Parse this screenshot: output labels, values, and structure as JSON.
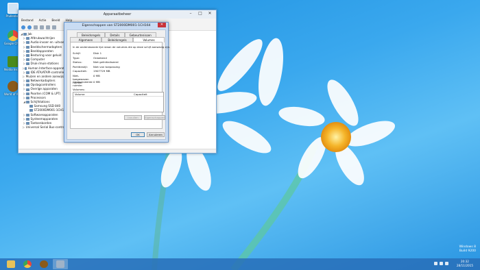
{
  "desktop": {
    "icons": [
      {
        "label": "Prullenbak",
        "icon": "recycle-bin-icon",
        "color": "#cfe3f5"
      },
      {
        "label": "Google Chrome",
        "icon": "chrome-icon",
        "color": "#e8453c"
      },
      {
        "label": "Nvidia Inspector",
        "icon": "nvidia-icon",
        "color": "#4a8a1c"
      },
      {
        "label": "World of Warcraft",
        "icon": "wow-icon",
        "color": "#8a5a1a"
      }
    ],
    "watermark": {
      "line1": "Windows 8",
      "line2": "Build 9200"
    }
  },
  "device_manager": {
    "title": "Apparaatbeheer",
    "menu": [
      "Bestand",
      "Actie",
      "Beeld",
      "Help"
    ],
    "root": "Jak",
    "tree": [
      {
        "label": "Afdrukwachtrijen",
        "expanded": false
      },
      {
        "label": "Audio-invoer en -uitvoer",
        "expanded": false
      },
      {
        "label": "Beeldschermadapters",
        "expanded": false
      },
      {
        "label": "Beeldapparaten",
        "expanded": false
      },
      {
        "label": "Besturing voor geluid",
        "expanded": false
      },
      {
        "label": "Computer",
        "expanded": false
      },
      {
        "label": "Druk-/muis-stations",
        "expanded": false
      },
      {
        "label": "Human Interface-apparaten",
        "expanded": false
      },
      {
        "label": "IDE ATA/ATAPI-controllers",
        "expanded": false
      },
      {
        "label": "Muizen en andere aanwijsapparaten",
        "expanded": false
      },
      {
        "label": "Netwerkadapters",
        "expanded": false
      },
      {
        "label": "Opslagcontrollers",
        "expanded": false
      },
      {
        "label": "Overige apparaten",
        "expanded": false
      },
      {
        "label": "Poorten (COM & LPT)",
        "expanded": false
      },
      {
        "label": "Processors",
        "expanded": false
      },
      {
        "label": "Schijfstations",
        "expanded": true
      },
      {
        "label": "Samsung SSD 840",
        "child": true
      },
      {
        "label": "ST2000DM001-1CH164",
        "child": true
      },
      {
        "label": "Softwareapparaten",
        "expanded": false
      },
      {
        "label": "Systeemapparaten",
        "expanded": false
      },
      {
        "label": "Toetsenborden",
        "expanded": false
      },
      {
        "label": "Universal Serial Bus-controllers",
        "expanded": false
      }
    ]
  },
  "dialog": {
    "title": "Eigenschappen van ST2000DM001-1CH164",
    "tabs_row1": [
      "Beleidsregels",
      "Details",
      "Gebeurtenissen"
    ],
    "tabs_row2": [
      "Algemeen",
      "Beleidsregels",
      "Volumes"
    ],
    "active_tab": "Volumes",
    "description": "In de onderstaande lijst staan de volumes die op deze schijf aanwezig zijn.",
    "fields": [
      {
        "key": "Schijf:",
        "value": "Disk 1"
      },
      {
        "key": "Type:",
        "value": "Onbekend"
      },
      {
        "key": "Status:",
        "value": "Niet geïnitialiseerd"
      },
      {
        "key": "Partitiestijl:",
        "value": "Niet van toepassing"
      },
      {
        "key": "Capaciteit:",
        "value": "1907729 MB"
      },
      {
        "key": "Niet-toegewezen ruimte:",
        "value": "0 MB"
      },
      {
        "key": "Gereserveerde ruimte:",
        "value": "0 MB"
      }
    ],
    "volumes_label": "Volumes:",
    "table_headers": [
      "Volume",
      "Capaciteit"
    ],
    "btn_fill": "Invullen",
    "btn_properties": "Eigenschappen",
    "btn_ok": "OK",
    "btn_cancel": "Annuleren"
  },
  "taskbar": {
    "apps": [
      {
        "icon": "file-explorer-icon",
        "color": "#e7c25a"
      },
      {
        "icon": "chrome-icon",
        "color": "#e8453c"
      },
      {
        "icon": "wow-icon",
        "color": "#8a5a1a"
      },
      {
        "icon": "device-manager-icon",
        "color": "#9fb3c8"
      }
    ],
    "time": "20:32",
    "date": "28/11/2015"
  }
}
